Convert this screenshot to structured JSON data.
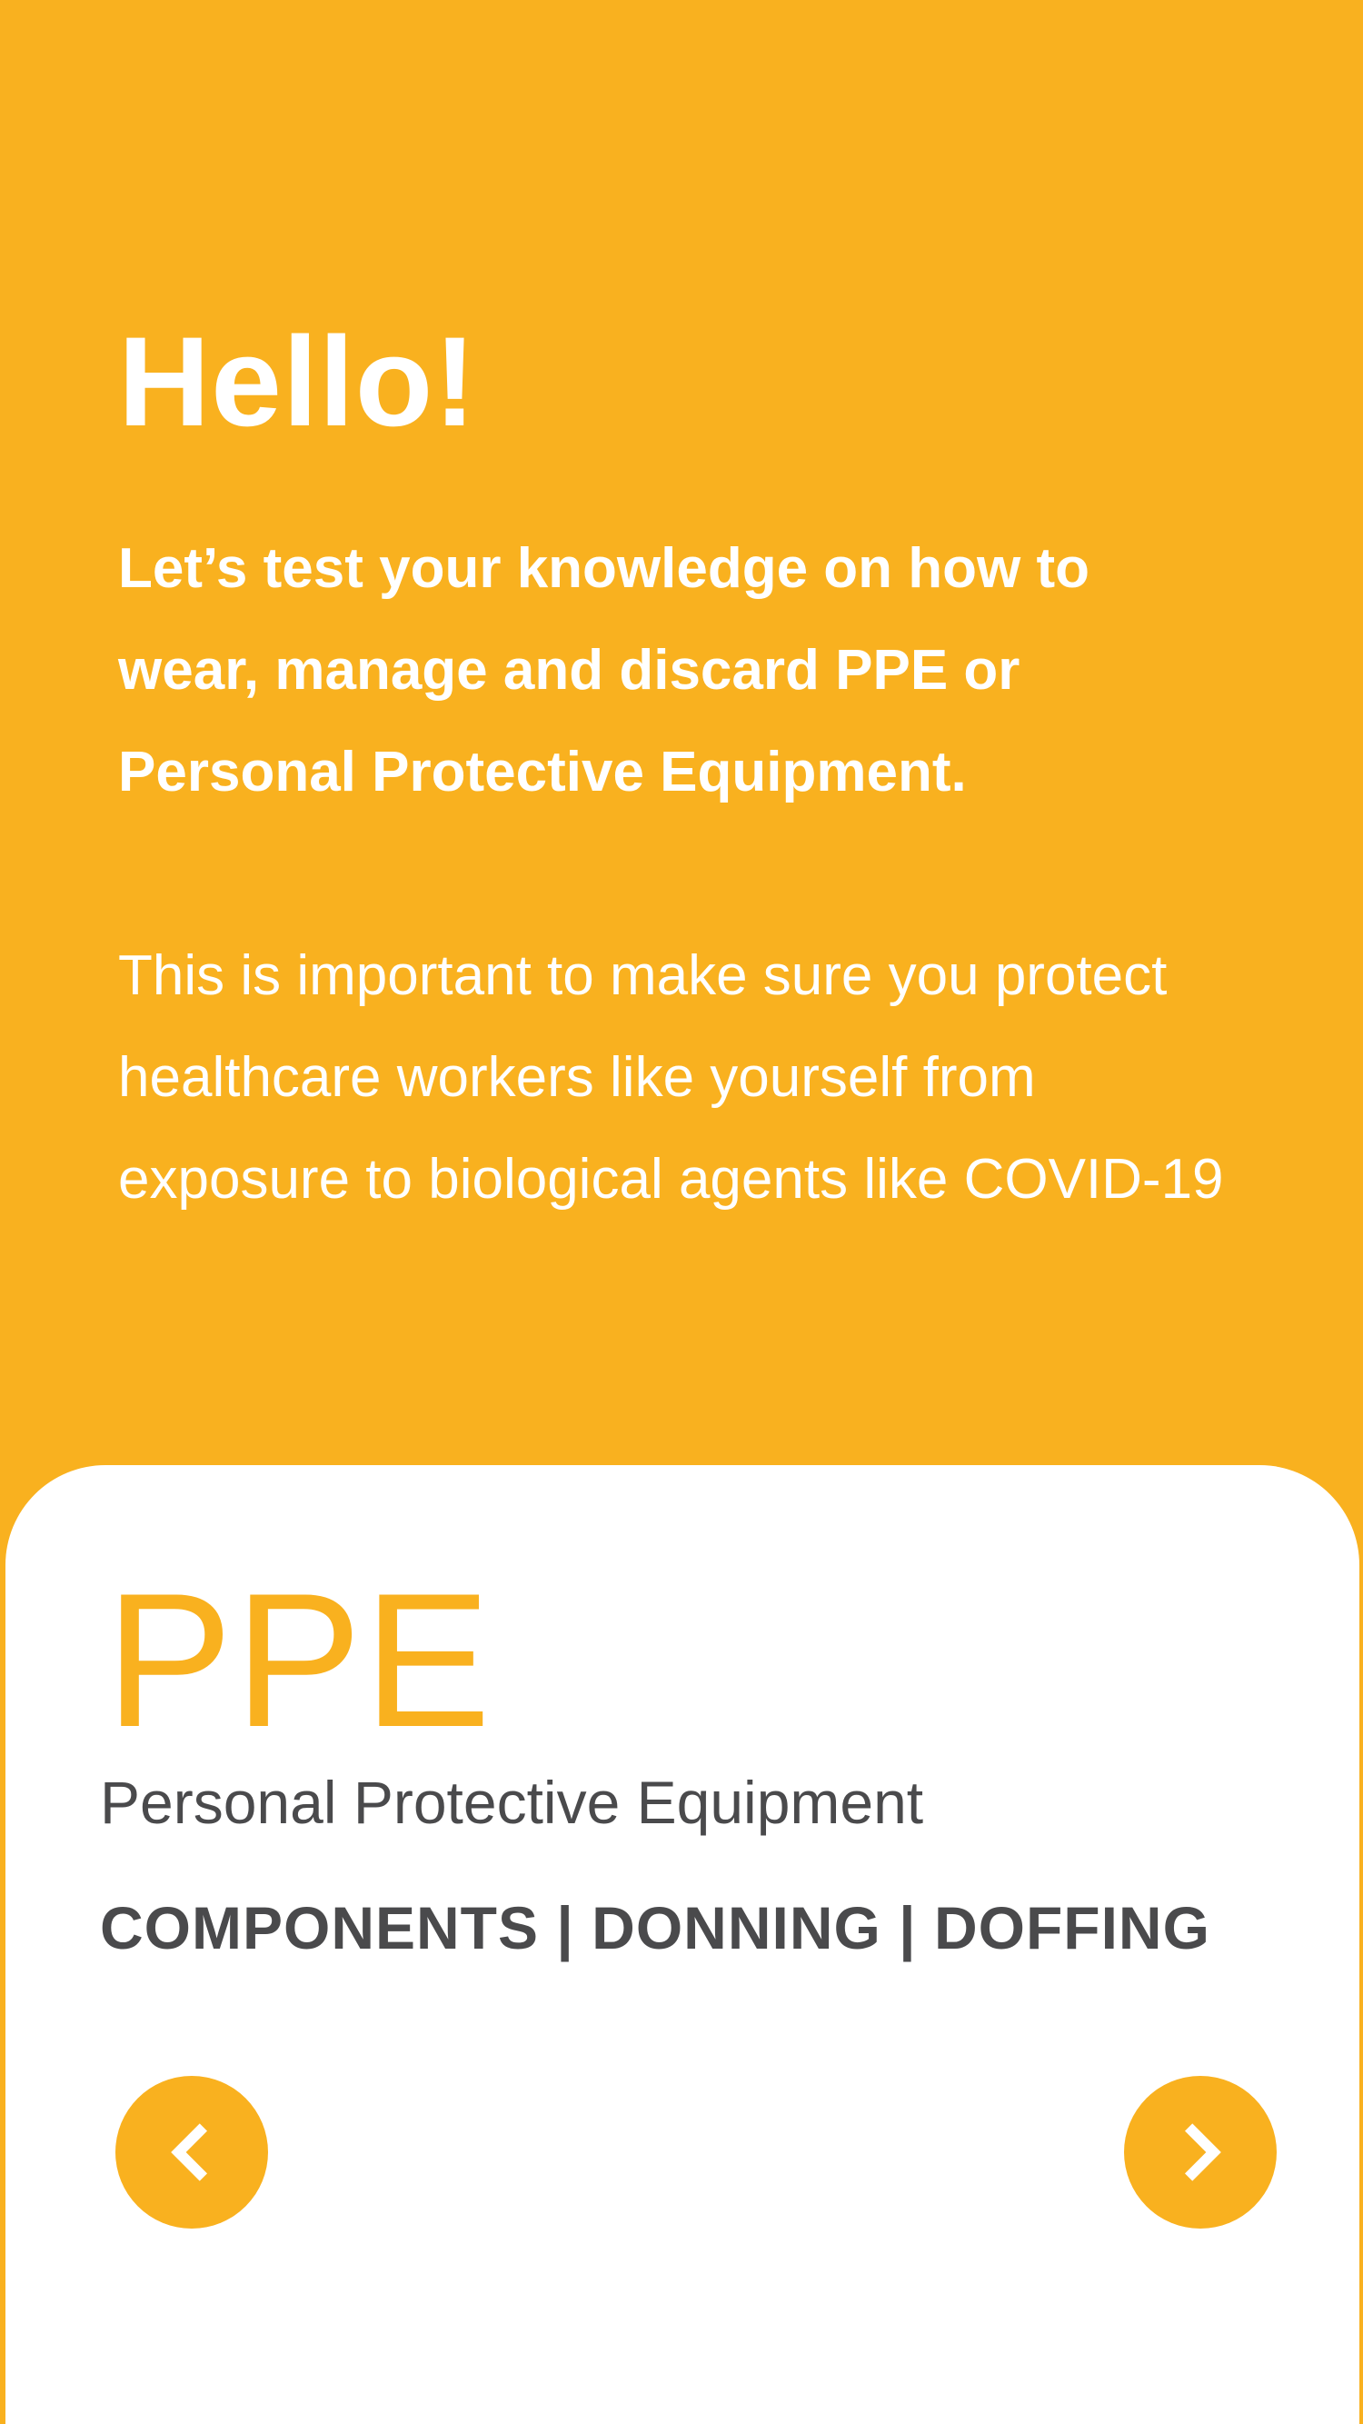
{
  "theme": {
    "accent": "#F9B11F",
    "card_background": "#FFFFFF",
    "text_dark": "#4A4A4C",
    "text_light": "#FFFFFF"
  },
  "intro": {
    "greeting": "Hello!",
    "lead": "Let’s test your knowledge on how to wear, manage and discard PPE or Personal Protective Equipment.",
    "body": "This is important to make sure you protect healthcare workers like yourself from exposure to biological agents like COVID-19"
  },
  "card": {
    "title": "PPE",
    "subtitle": "Personal Protective Equipment",
    "links": "COMPONENTS | DONNING | DOFFING"
  },
  "navigation": {
    "prev_icon": "chevron-left-icon",
    "next_icon": "chevron-right-icon"
  }
}
